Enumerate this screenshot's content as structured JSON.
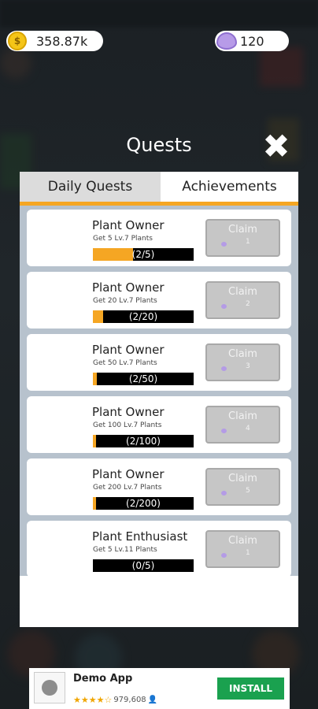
{
  "hud": {
    "coins": "358.87k",
    "gems": "120"
  },
  "modal": {
    "title": "Quests",
    "close_symbol": "✖",
    "tabs": [
      {
        "label": "Daily Quests",
        "active": true
      },
      {
        "label": "Achievements",
        "active": false
      }
    ]
  },
  "quests": [
    {
      "title": "Plant Owner",
      "description": "Get 5 Lv.7 Plants",
      "progress_text": "(2/5)",
      "progress_fraction": 0.4,
      "claim_label": "Claim",
      "reward": "1"
    },
    {
      "title": "Plant Owner",
      "description": "Get 20 Lv.7 Plants",
      "progress_text": "(2/20)",
      "progress_fraction": 0.1,
      "claim_label": "Claim",
      "reward": "2"
    },
    {
      "title": "Plant Owner",
      "description": "Get 50 Lv.7 Plants",
      "progress_text": "(2/50)",
      "progress_fraction": 0.04,
      "claim_label": "Claim",
      "reward": "3"
    },
    {
      "title": "Plant Owner",
      "description": "Get 100 Lv.7 Plants",
      "progress_text": "(2/100)",
      "progress_fraction": 0.02,
      "claim_label": "Claim",
      "reward": "4"
    },
    {
      "title": "Plant Owner",
      "description": "Get 200 Lv.7 Plants",
      "progress_text": "(2/200)",
      "progress_fraction": 0.01,
      "claim_label": "Claim",
      "reward": "5"
    },
    {
      "title": "Plant Enthusiast",
      "description": "Get 5 Lv.11 Plants",
      "progress_text": "(0/5)",
      "progress_fraction": 0,
      "claim_label": "Claim",
      "reward": "1"
    }
  ],
  "ad": {
    "app_name": "Demo App",
    "stars": "★★★★☆",
    "rating_count": "979,608",
    "install_label": "INSTALL"
  },
  "colors": {
    "progress_fill": "#f5a623",
    "tab_underline": "#f5a623",
    "install_green": "#1aa14f",
    "list_background": "#b7c2cd"
  },
  "icons": {
    "coin": "coin-icon",
    "gem": "gem-icon",
    "close": "close-icon"
  }
}
